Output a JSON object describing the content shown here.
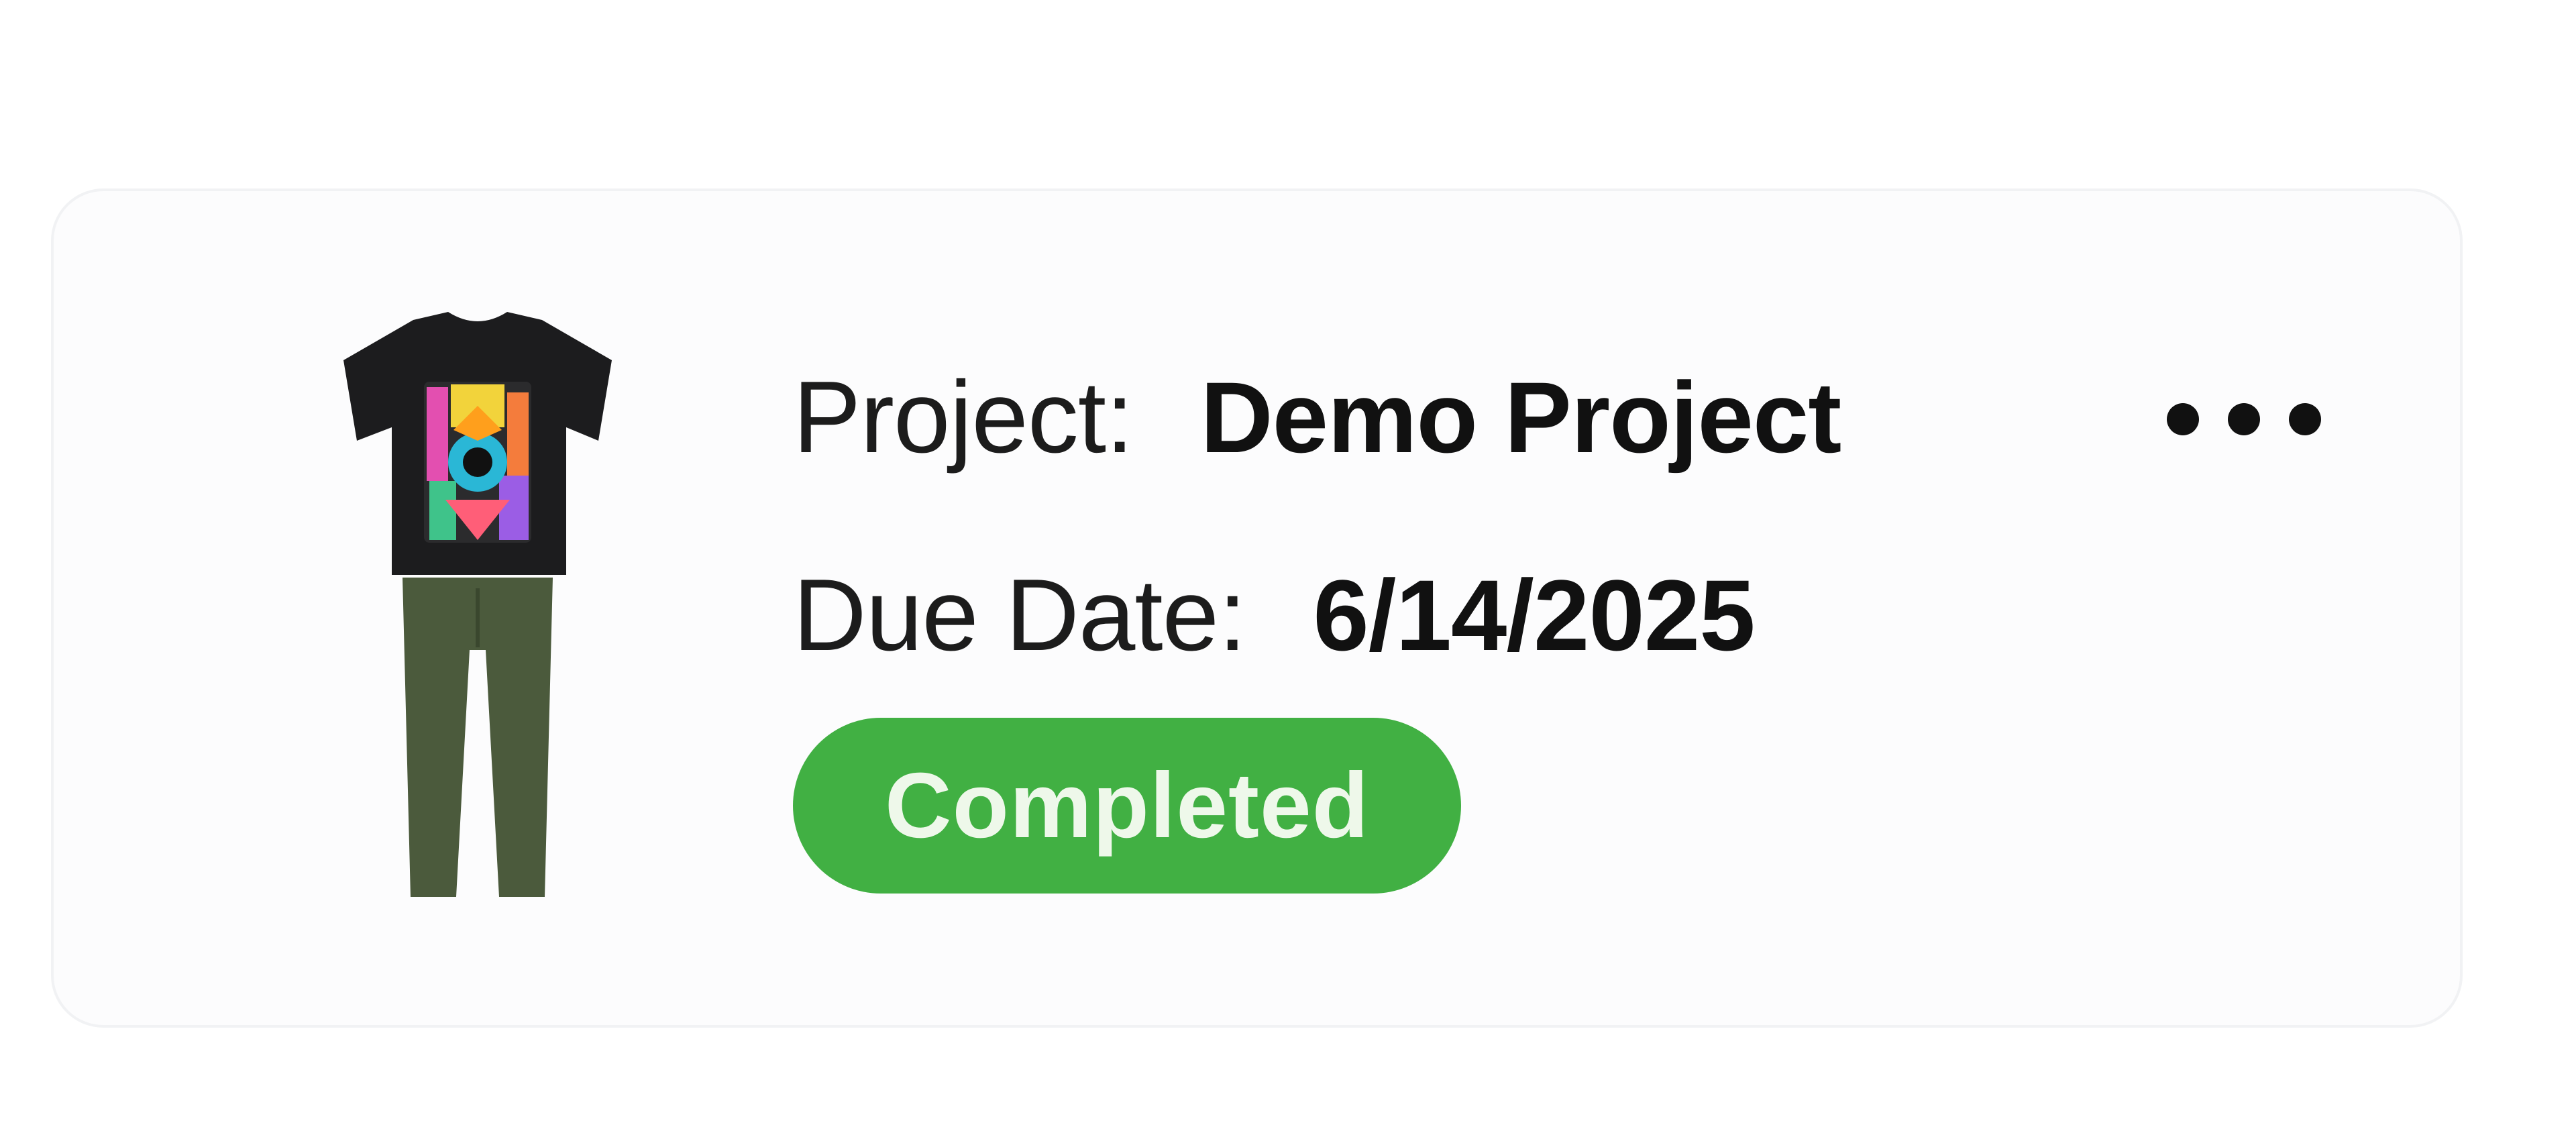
{
  "card": {
    "image_icon": "tshirt-and-pants-outfit-icon",
    "project_label": "Project:",
    "project_value": "Demo Project",
    "due_label": "Due Date:",
    "due_value": "6/14/2025",
    "status": "Completed",
    "more_icon": "ellipsis-horizontal-icon"
  },
  "colors": {
    "status_bg": "#41b043",
    "status_text": "#eef8ea",
    "card_bg": "#fcfcfd",
    "card_border": "#f1f2f4",
    "text_primary": "#111111"
  }
}
